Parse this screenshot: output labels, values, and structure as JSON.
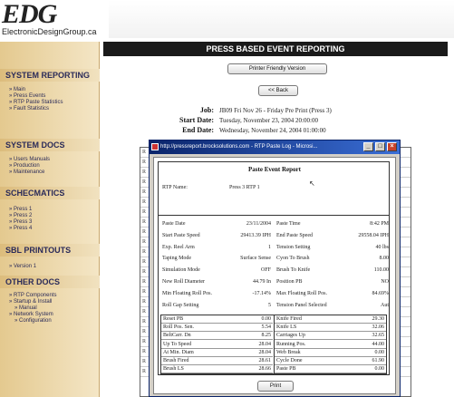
{
  "header": {
    "logo_text": "EDG",
    "logo_sub": "ElectronicDesignGroup.ca",
    "page_title": "PRESS BASED EVENT REPORTING"
  },
  "sidebar": {
    "sections": [
      {
        "heading": "SYSTEM REPORTING",
        "items": [
          "Main",
          "Press Events",
          "RTP Paste Statistics",
          "Fault Statistics"
        ]
      },
      {
        "heading": "SYSTEM DOCS",
        "items": [
          "Users Manuals",
          "Production",
          "Maintenance"
        ]
      },
      {
        "heading": "SCHECMATICS",
        "items": [
          "Press 1",
          "Press 2",
          "Press 3",
          "Press 4"
        ]
      },
      {
        "heading": "SBL PRINTOUTS",
        "items": [
          "Version 1"
        ]
      },
      {
        "heading": "OTHER DOCS",
        "items": [
          "RTP Components",
          "Startup & Install",
          "Manual",
          "Network System",
          "Configuration"
        ]
      }
    ]
  },
  "main": {
    "printer_friendly_label": "Printer Friendly Version",
    "back_label": "<< Back",
    "job_label": "Job:",
    "job_value": "JB09 Fri Nov 26 - Friday Pre Print (Press 3)",
    "start_label": "Start Date:",
    "start_value": "Tuesday, November 23, 2004 20:00:00",
    "end_label": "End Date:",
    "end_value": "Wednesday, November 24, 2004 01:00:00"
  },
  "background_rows": [
    "R",
    "R",
    "R",
    "R",
    "R",
    "R",
    "R",
    "R",
    "R",
    "R",
    "R",
    "R",
    "R",
    "R",
    "R",
    "R",
    "R",
    "R",
    "R",
    "R",
    "R",
    "R",
    "R"
  ],
  "popup": {
    "window_title": "http://pressreport.brocksolutions.com - RTP Paste Log - Microsi...",
    "report_title": "Paste Event Report",
    "rtp_name_label": "RTP Name:",
    "rtp_name_value": "Press 3 RTP 1",
    "fields_left": [
      {
        "label": "Paste Date",
        "value": "23/11/2004"
      },
      {
        "label": "Start Paste Speed",
        "value": "29413.39 IPH"
      },
      {
        "label": "Exp. Reel Arm",
        "value": "1"
      },
      {
        "label": "Taping Mode",
        "value": "Surface Sense"
      },
      {
        "label": "Simulation Mode",
        "value": "OFF"
      },
      {
        "label": "New Roll Diameter",
        "value": "44.79 In"
      },
      {
        "label": "Min Floating Roll Pos.",
        "value": "-17.14%"
      },
      {
        "label": "Roll Gap Setting",
        "value": "5"
      }
    ],
    "fields_right": [
      {
        "label": "Paste Time",
        "value": "8:42 PM"
      },
      {
        "label": "End Paste Speed",
        "value": "29558.04 IPH"
      },
      {
        "label": "Tension Setting",
        "value": "40 lbs"
      },
      {
        "label": "Cyon To Brush",
        "value": "8.00"
      },
      {
        "label": "Brush To Knife",
        "value": "110.00"
      },
      {
        "label": "Position PB",
        "value": "NO"
      },
      {
        "label": "Max Floating Roll Pos.",
        "value": "84.69%"
      },
      {
        "label": "Tension Panel Selected",
        "value": "Aut"
      }
    ],
    "grid_left": [
      {
        "label": "Reset PB",
        "value": "0.00"
      },
      {
        "label": "Roll Pos. Sen.",
        "value": "5.54"
      },
      {
        "label": "BeltCarr. Dn",
        "value": "8.25"
      },
      {
        "label": "Up To Speed",
        "value": "28.04"
      },
      {
        "label": "At Min. Diam",
        "value": "28.04"
      },
      {
        "label": "Brush Fired",
        "value": "28.61"
      },
      {
        "label": "Brush LS",
        "value": "28.66"
      }
    ],
    "grid_right": [
      {
        "label": "Knife Fired",
        "value": "29.30"
      },
      {
        "label": "Knife LS",
        "value": "32.06"
      },
      {
        "label": "Carriages Up",
        "value": "32.65"
      },
      {
        "label": "Running Pos.",
        "value": "44.00"
      },
      {
        "label": "Web Break",
        "value": "0.00"
      },
      {
        "label": "Cycle Done",
        "value": "61.90"
      },
      {
        "label": "Paste PB",
        "value": "0.00"
      }
    ],
    "print_label": "Print",
    "win_min": "_",
    "win_max": "□",
    "win_close": "×"
  }
}
